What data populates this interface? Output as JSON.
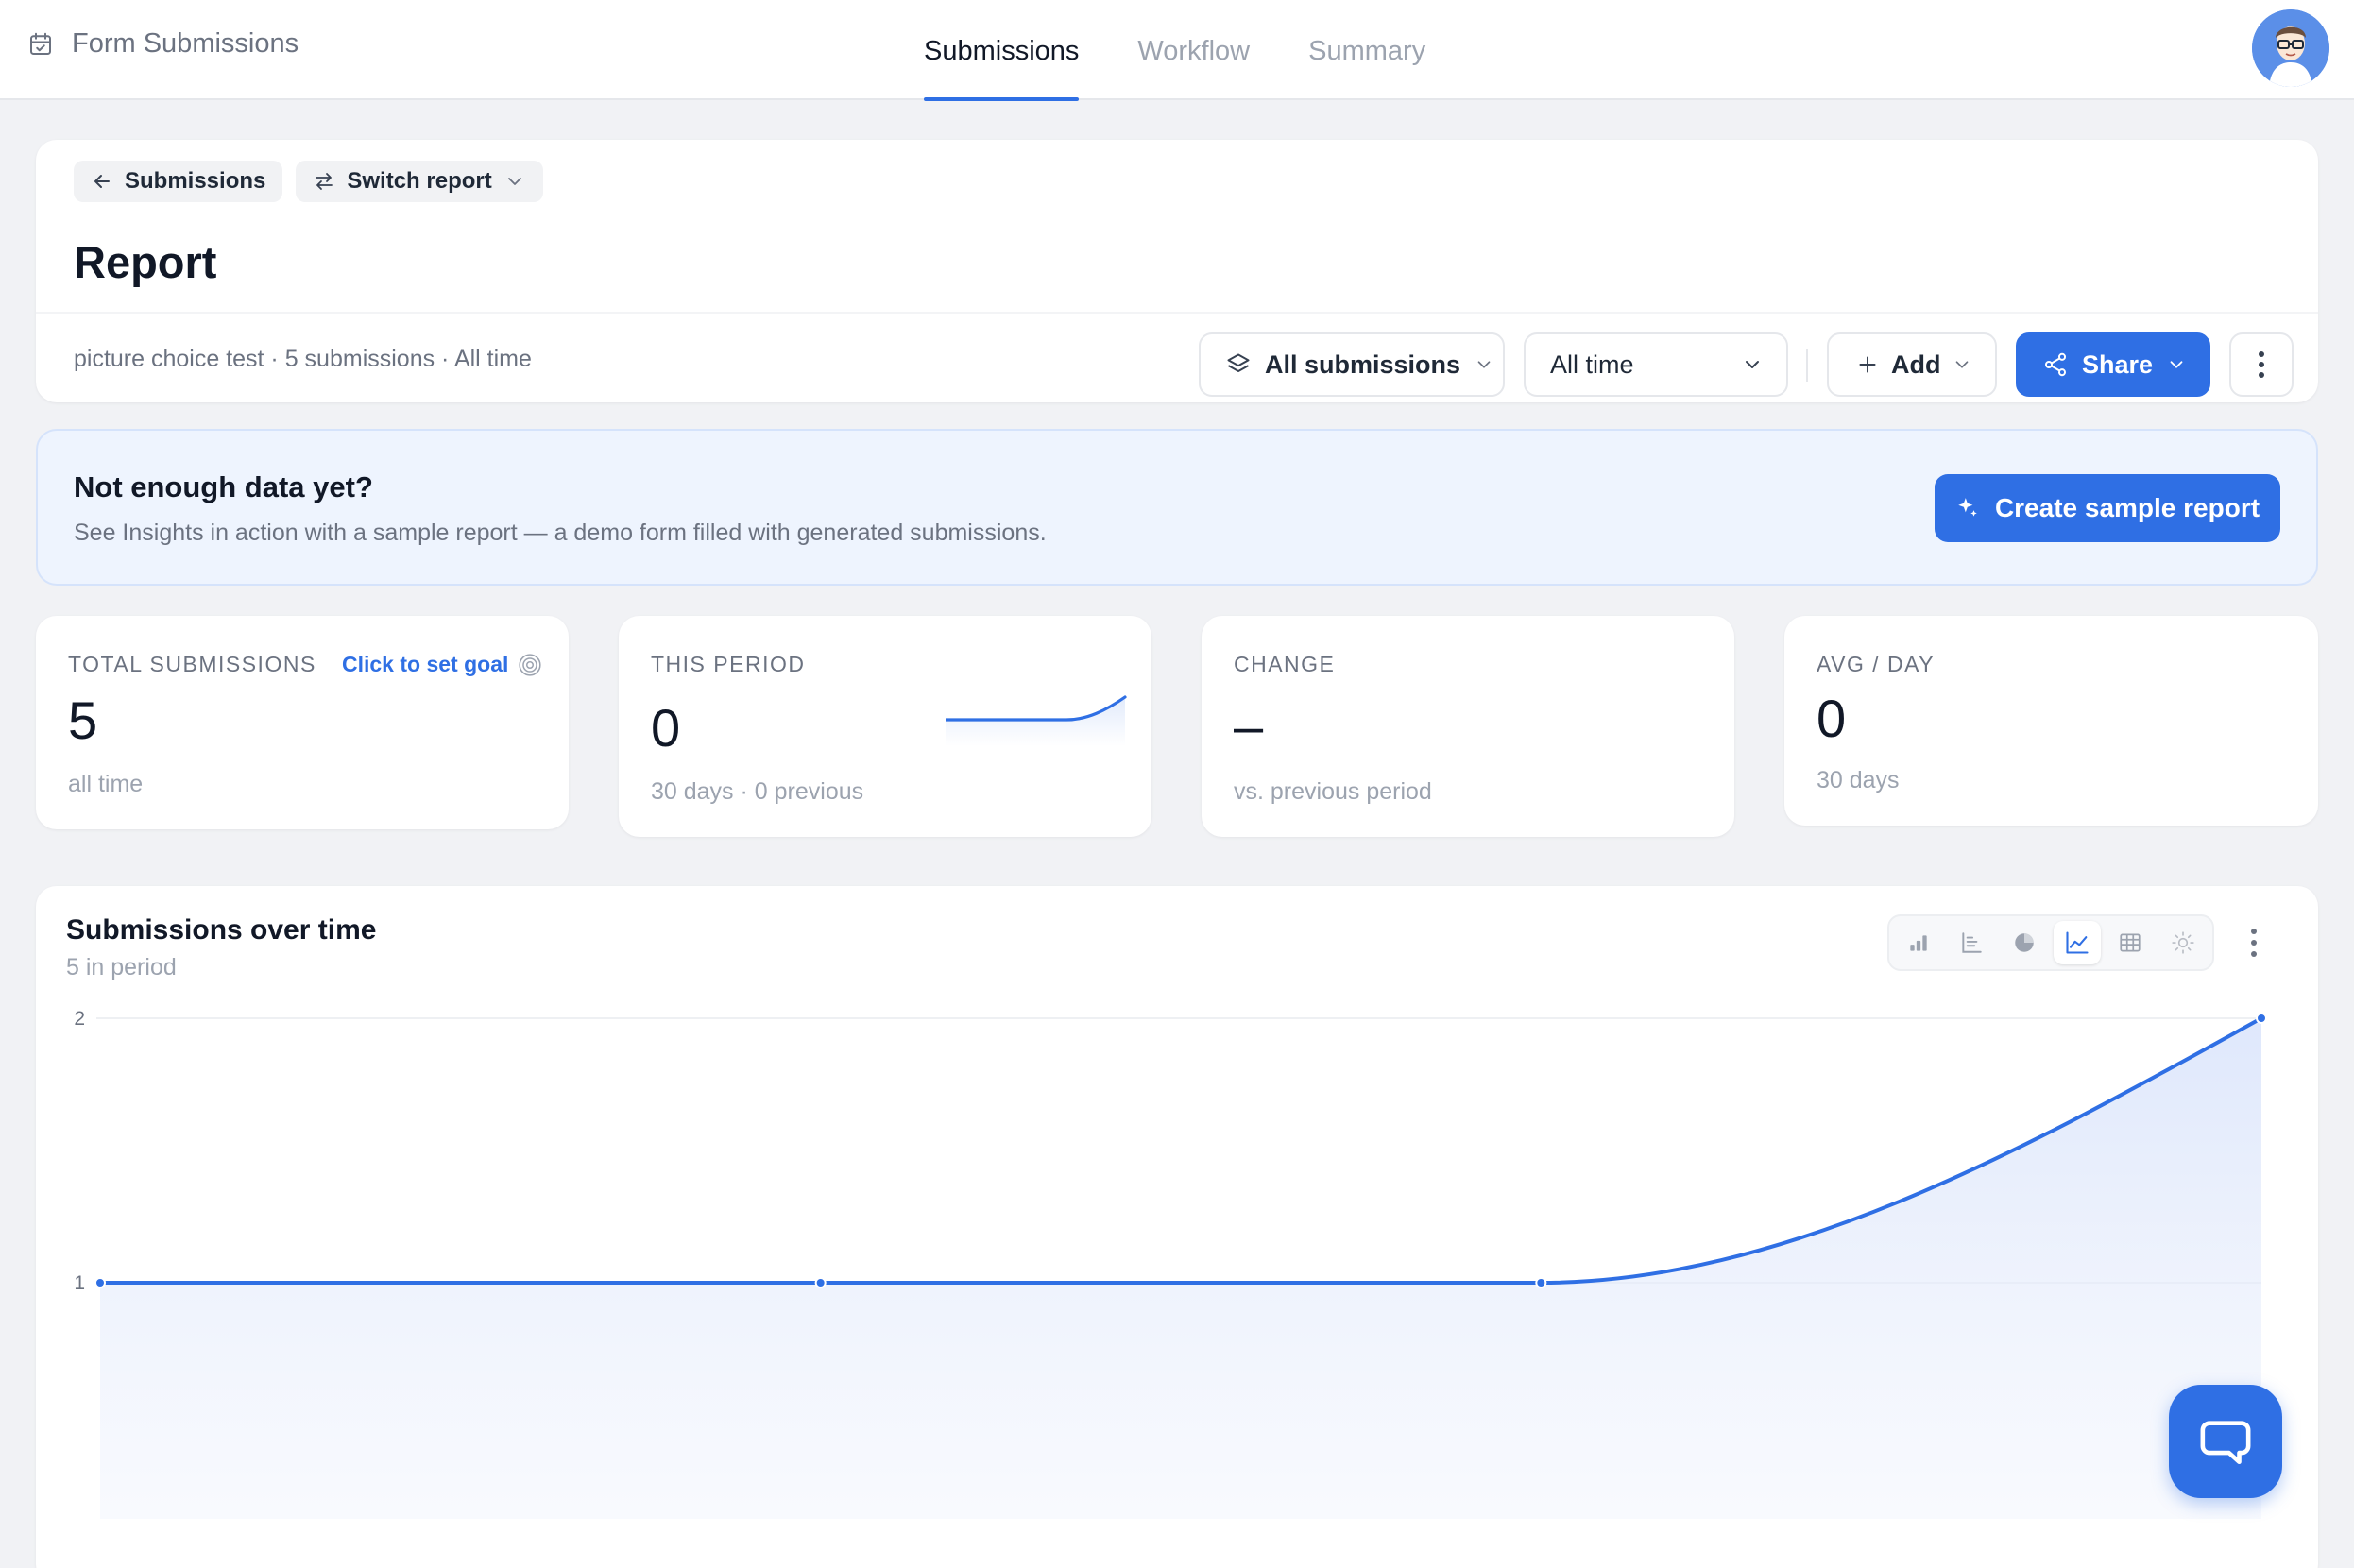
{
  "app": {
    "title": "Form Submissions"
  },
  "nav": {
    "tabs": [
      {
        "label": "Submissions",
        "active": true
      },
      {
        "label": "Workflow",
        "active": false
      },
      {
        "label": "Summary",
        "active": false
      }
    ]
  },
  "crumbs": {
    "back_label": "Submissions",
    "switch_label": "Switch report"
  },
  "report": {
    "title": "Report",
    "meta": "picture choice test · 5 submissions · All time"
  },
  "controls": {
    "filter_label": "All submissions",
    "range_label": "All time",
    "add_label": "Add",
    "share_label": "Share"
  },
  "banner": {
    "title": "Not enough data yet?",
    "description": "See Insights in action with a sample report — a demo form filled with generated submissions.",
    "button_label": "Create sample report"
  },
  "stats": {
    "total": {
      "label": "TOTAL SUBMISSIONS",
      "goal_link": "Click to set goal",
      "value": "5",
      "sub": "all time"
    },
    "period": {
      "label": "THIS PERIOD",
      "value": "0",
      "sub": "30 days · 0 previous"
    },
    "change": {
      "label": "CHANGE",
      "value": "–",
      "sub": "vs. previous period"
    },
    "avg": {
      "label": "AVG / DAY",
      "value": "0",
      "sub": "30 days"
    }
  },
  "chart": {
    "title": "Submissions over time",
    "subtitle": "5 in period"
  },
  "colors": {
    "accent": "#2f6fe4",
    "area": "#e6edfb"
  },
  "icons": {
    "brand": "calendar-check-icon",
    "view_types": [
      "bar-chart-icon",
      "horizontal-bar-icon",
      "pie-chart-icon",
      "line-chart-icon",
      "table-icon",
      "sun-icon"
    ]
  },
  "chart_data": {
    "type": "line",
    "x": [
      1,
      2,
      3,
      4
    ],
    "values": [
      1,
      1,
      1,
      2
    ],
    "yticks": [
      "0",
      "1",
      "2"
    ],
    "ylim": [
      0,
      2
    ],
    "grid": true,
    "area_fill": true
  }
}
